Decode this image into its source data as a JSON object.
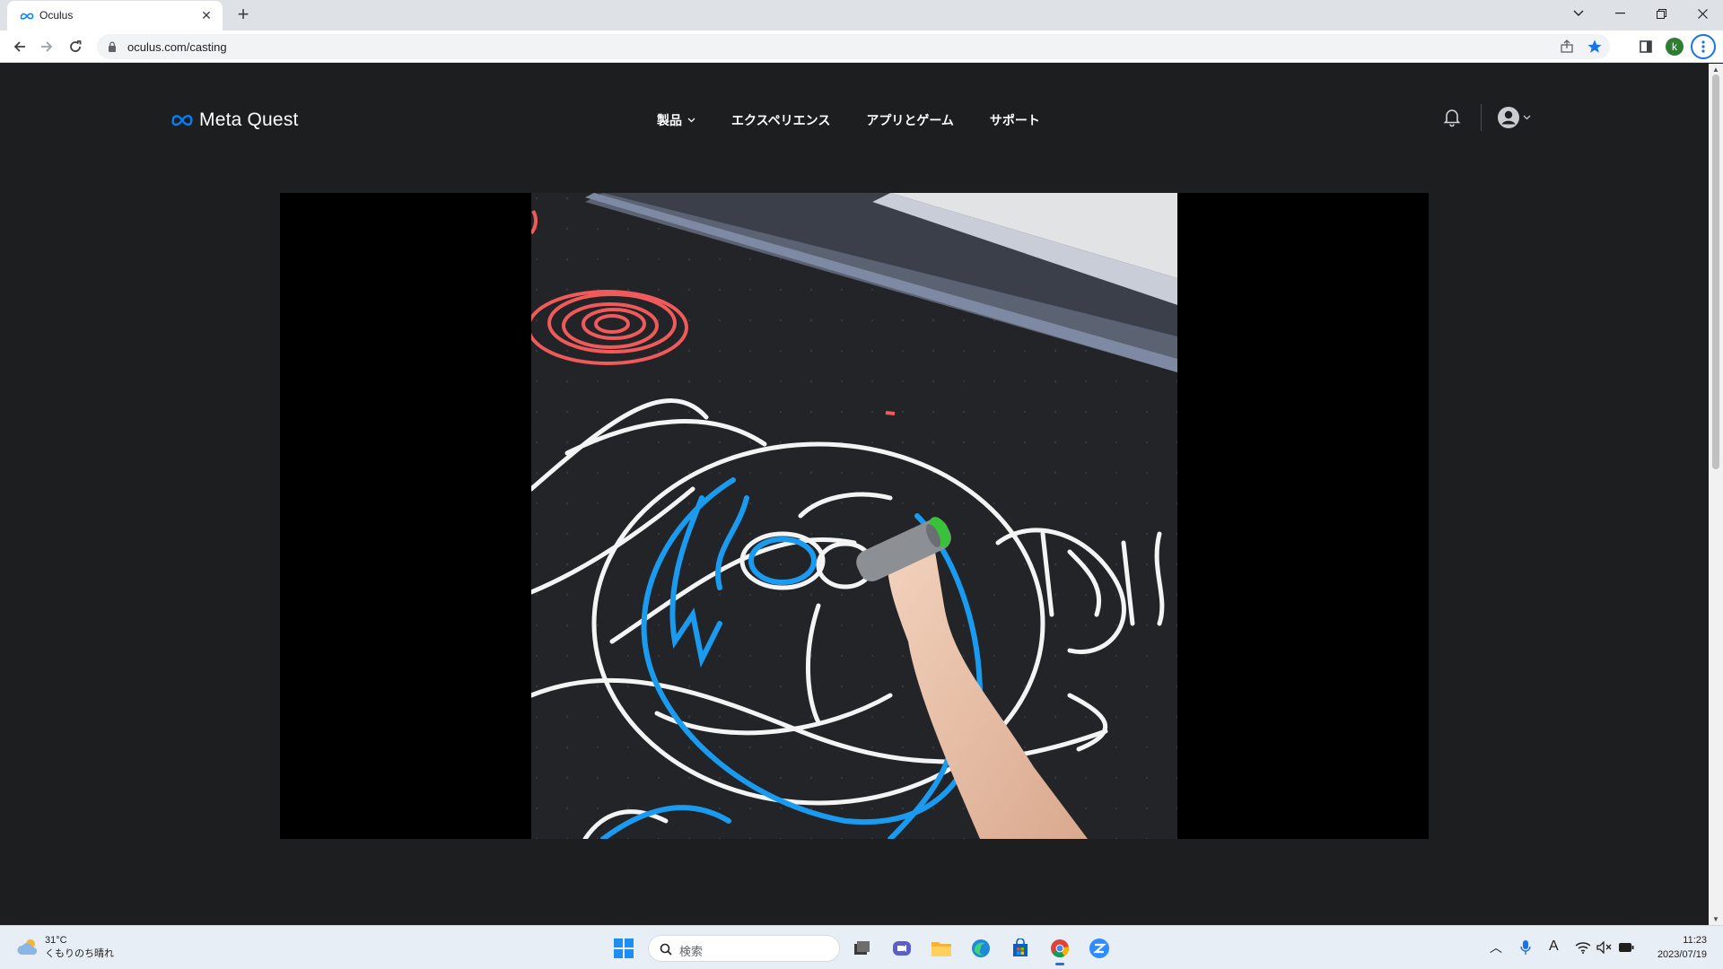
{
  "browser": {
    "tab_title": "Oculus",
    "url": "oculus.com/casting",
    "profile_initial": "k"
  },
  "site": {
    "logo_text": "Meta Quest",
    "nav": [
      {
        "label": "製品"
      },
      {
        "label": "エクスペリエンス"
      },
      {
        "label": "アプリとゲーム"
      },
      {
        "label": "サポート"
      }
    ]
  },
  "taskbar": {
    "weather_temp": "31°C",
    "weather_condition": "くもりのち晴れ",
    "search_placeholder": "検索",
    "time": "11:23",
    "date": "2023/07/19"
  },
  "colors": {
    "page_bg": "#1c1e20",
    "accent": "#1a73e8",
    "meta_blue": "#0081fb"
  }
}
